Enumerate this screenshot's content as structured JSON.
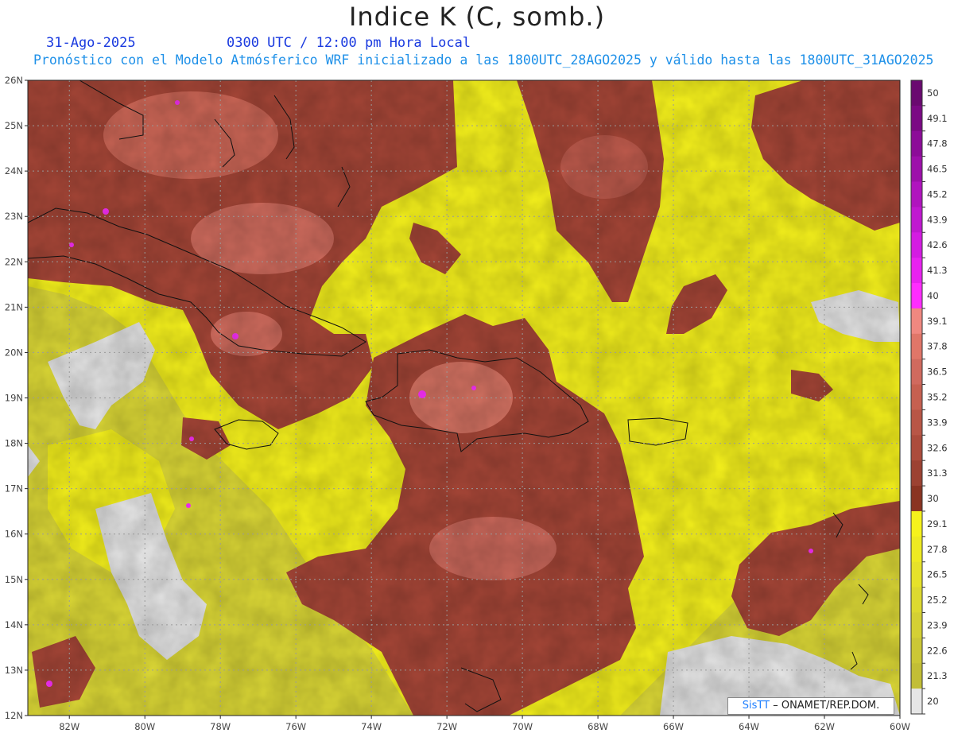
{
  "header": {
    "title": "Indice K (C, somb.)",
    "date": "31-Ago-2025",
    "time": "0300 UTC / 12:00 pm Hora Local",
    "forecast_line": "Pronóstico con el Modelo Atmósferico WRF inicializado a las 1800UTC_28AGO2025 y válido hasta las  1800UTC_31AGO2025"
  },
  "map": {
    "lat_labels": [
      "26N",
      "25N",
      "24N",
      "23N",
      "22N",
      "21N",
      "20N",
      "19N",
      "18N",
      "17N",
      "16N",
      "15N",
      "14N",
      "13N",
      "12N"
    ],
    "lon_labels": [
      "82W",
      "80W",
      "78W",
      "76W",
      "74W",
      "72W",
      "70W",
      "68W",
      "66W",
      "64W",
      "62W",
      "60W"
    ],
    "lat_range": [
      12,
      26
    ],
    "lon_range": [
      -83.1,
      -60
    ],
    "grid": true,
    "colors": {
      "low_fill": "#d6d94a",
      "mid_fill": "#f7f21e",
      "high_fill": "#a64637",
      "peak_fill": "#d07060",
      "extreme_fill": "#ff30ff",
      "no_data": "#e6e6e6",
      "coast": "#111111"
    }
  },
  "colorbar": {
    "labels": [
      "50",
      "49.1",
      "47.8",
      "46.5",
      "45.2",
      "43.9",
      "42.6",
      "41.3",
      "40",
      "39.1",
      "37.8",
      "36.5",
      "35.2",
      "33.9",
      "32.6",
      "31.3",
      "30",
      "29.1",
      "27.8",
      "26.5",
      "25.2",
      "23.9",
      "22.6",
      "21.3",
      "20"
    ],
    "colors": [
      "#6a0a70",
      "#7b0a84",
      "#8c0c98",
      "#9d10aa",
      "#b014be",
      "#c018d0",
      "#d41ce2",
      "#e822f0",
      "#ff2dff",
      "#f08880",
      "#e07668",
      "#d06a5e",
      "#c66050",
      "#b85646",
      "#ac4c3c",
      "#9c4232",
      "#8a3422",
      "#f6f21c",
      "#eeea22",
      "#e6e22a",
      "#ddd930",
      "#d4d034",
      "#cbc736",
      "#c2be36",
      "#e6e6e6"
    ]
  },
  "credit": {
    "brand": "SisTT",
    "text": "– ONAMET/REP.DOM."
  }
}
